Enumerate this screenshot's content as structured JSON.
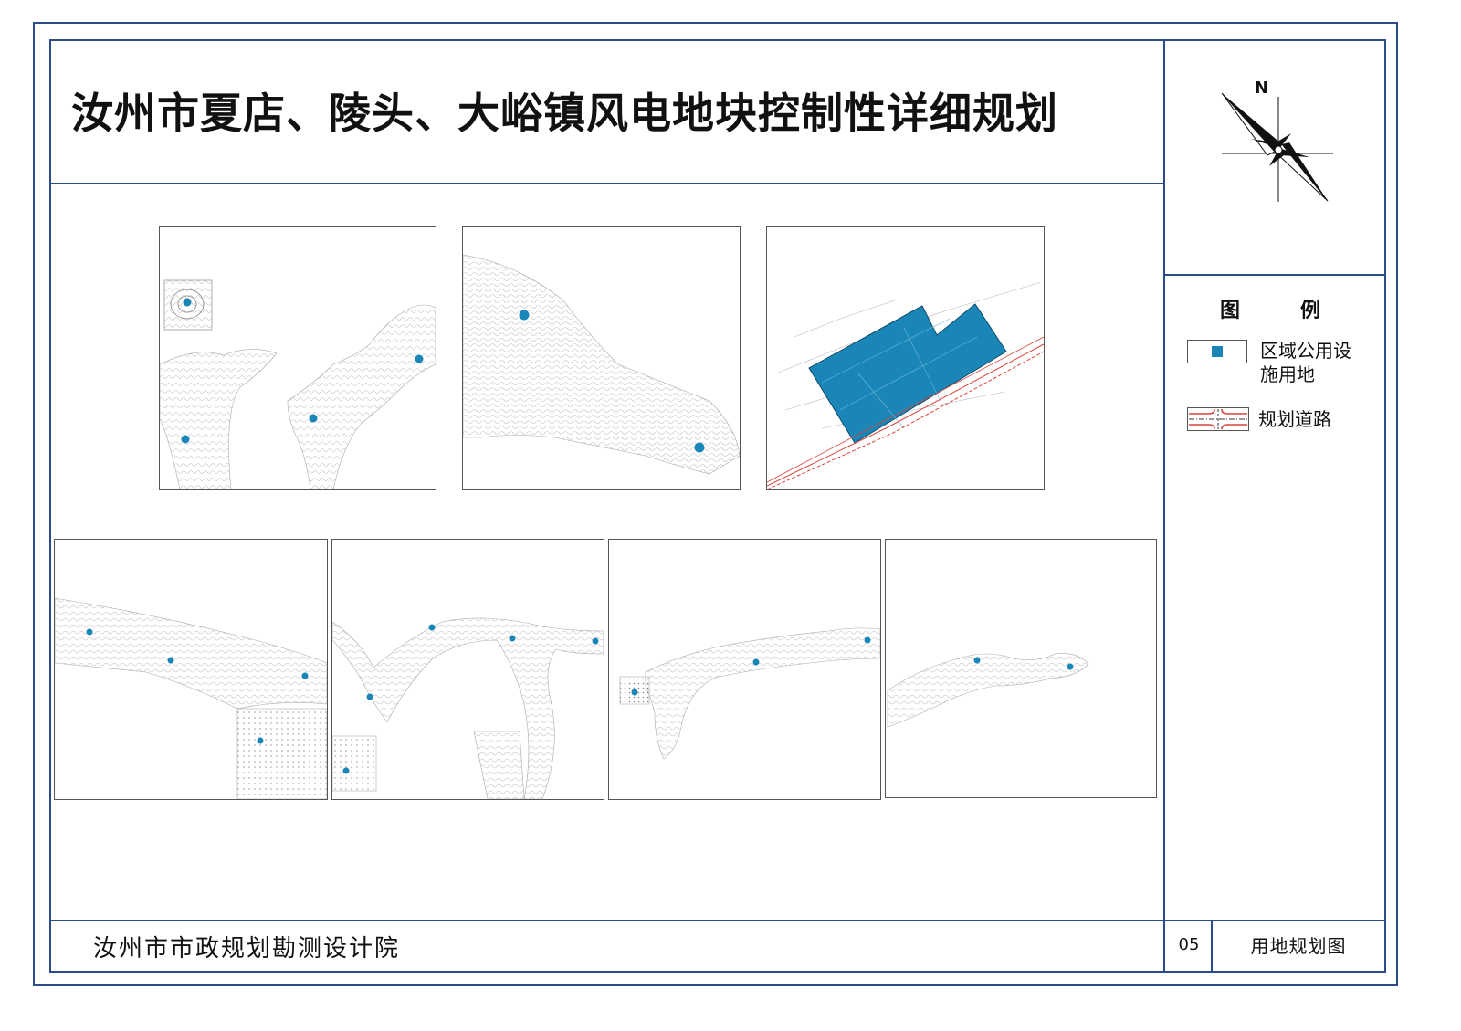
{
  "title": "汝州市夏店、陵头、大峪镇风电地块控制性详细规划",
  "compass": {
    "north_label": "N"
  },
  "legend": {
    "heading_left": "图",
    "heading_right": "例",
    "items": [
      {
        "label_line1": "区域公用设",
        "label_line2": "施用地",
        "color": "#1a86b8"
      },
      {
        "label_line1": "规划道路",
        "label_line2": "",
        "color": "#d9453b"
      }
    ]
  },
  "footer": {
    "institute": "汝州市市政规划勘测设计院",
    "page_number": "05",
    "sheet_name": "用地规划图"
  },
  "colors": {
    "frame": "#2b4d86",
    "landuse": "#1a86b8",
    "road": "#d9453b"
  }
}
